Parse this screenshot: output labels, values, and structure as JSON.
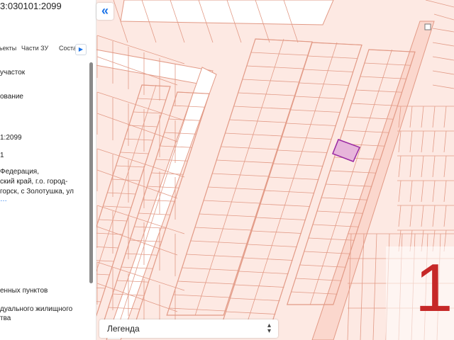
{
  "panel": {
    "title": "3:030101:2099",
    "tabs": [
      "ъекты",
      "Части ЗУ",
      "Состав"
    ],
    "rows": [
      "участок",
      "ование",
      "1:2099",
      "1",
      "Федерация,",
      "ский край, г.о. город-",
      "горск, с Золотушка, ул",
      "енных пунктов",
      "дуального жилищного",
      "тва"
    ]
  },
  "legend": {
    "label": "Легенда"
  },
  "badge": {
    "number": "1"
  },
  "colors": {
    "map_bg": "#fde9e3",
    "parcel_stroke": "#e29a86",
    "selected_fill": "#e7b5db",
    "selected_stroke": "#9a2aa3",
    "accent": "#1a73e8",
    "badge_number": "#c62828"
  }
}
